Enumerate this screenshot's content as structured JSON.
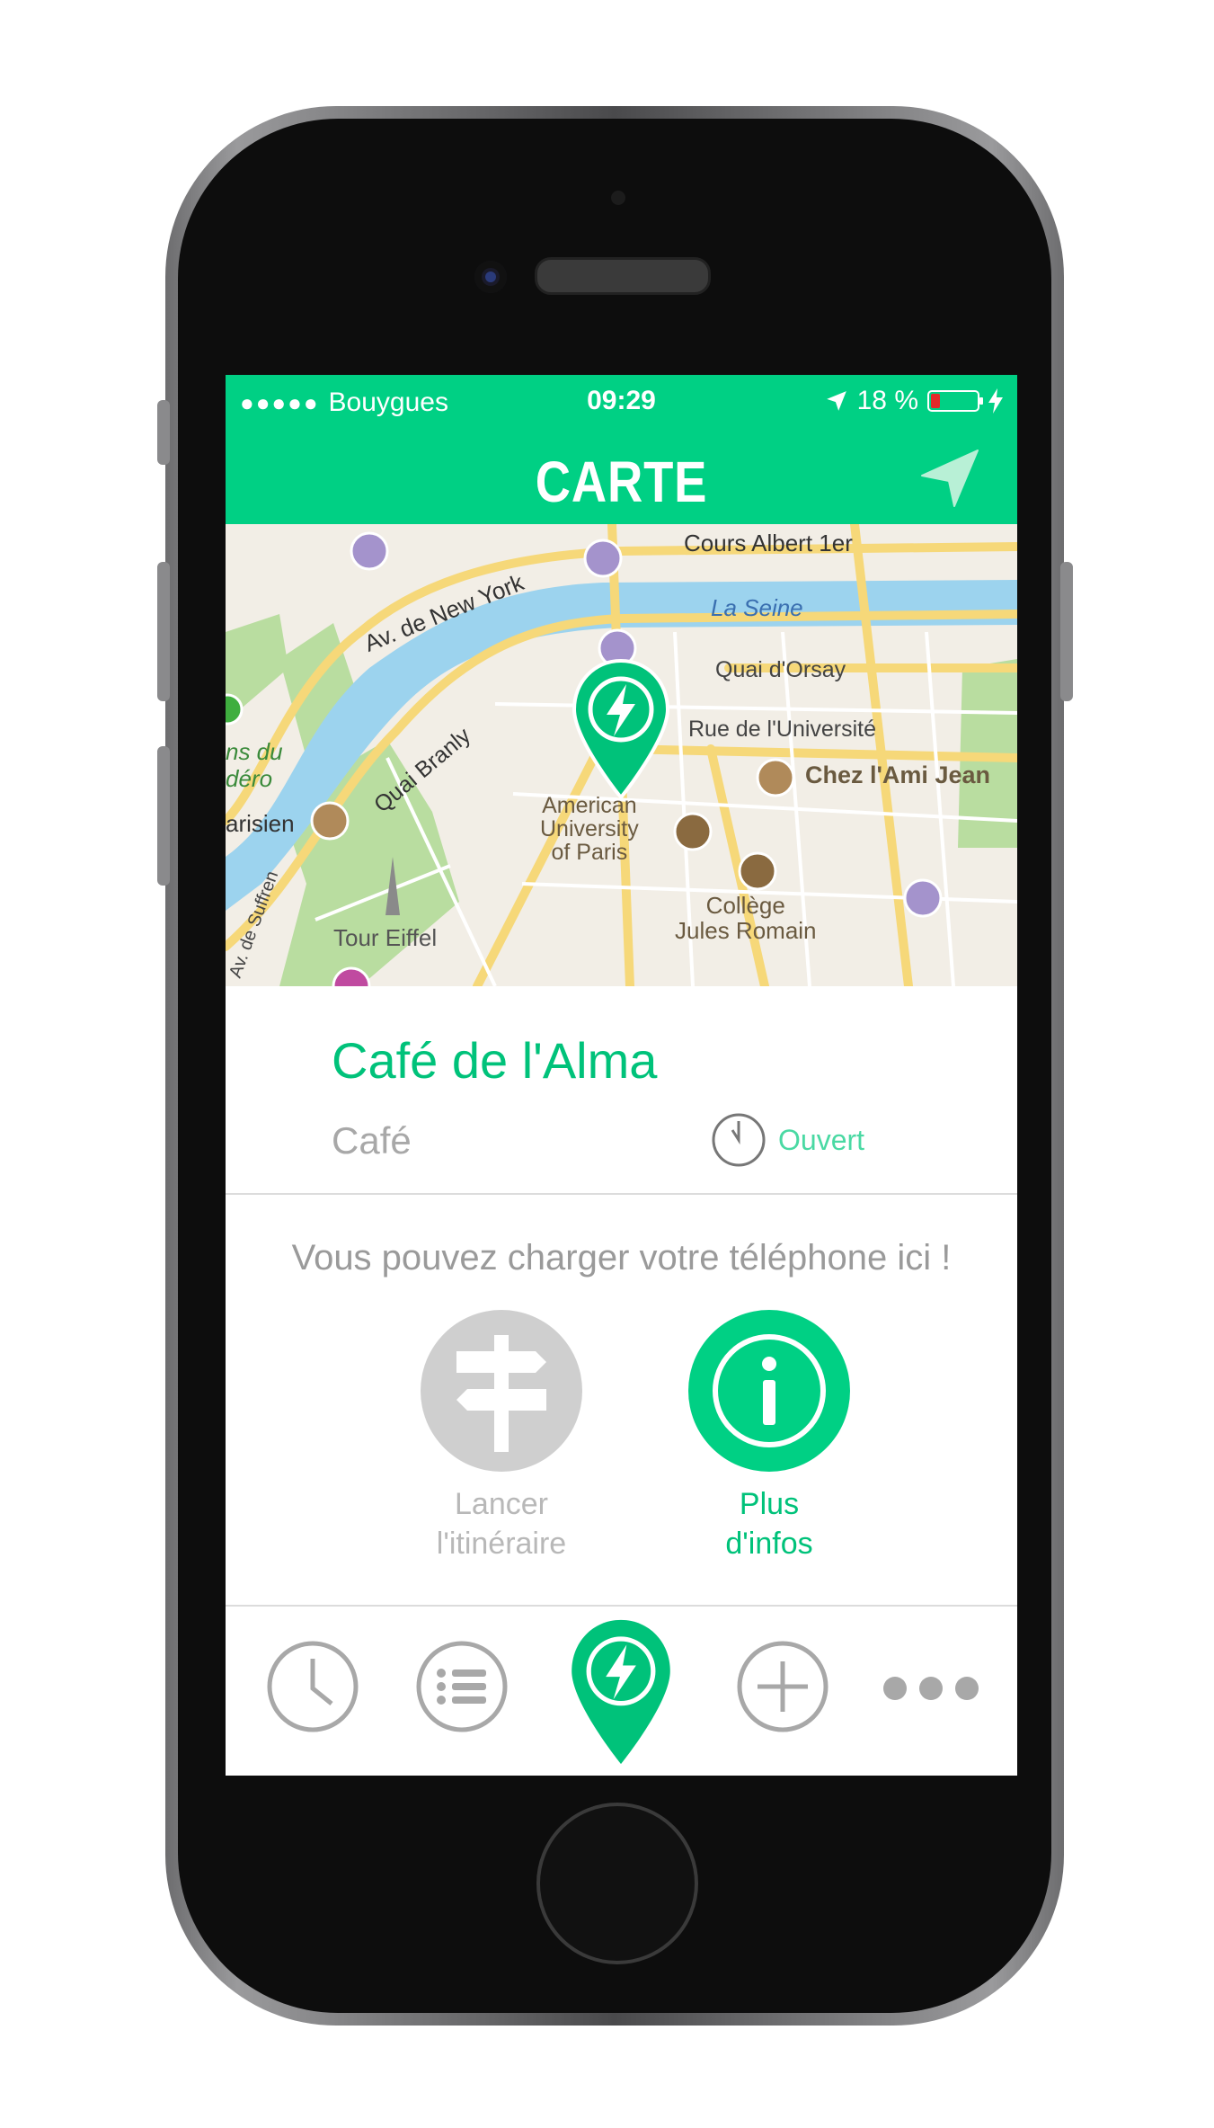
{
  "status_bar": {
    "carrier": "Bouygues",
    "time": "09:29",
    "battery": "18 %"
  },
  "nav": {
    "title": "CARTE"
  },
  "map": {
    "labels": {
      "cours_albert": "Cours Albert 1er",
      "seine": "La Seine",
      "av_new_york": "Av. de New York",
      "quai_orsay": "Quai d'Orsay",
      "rue_universite": "Rue de l'Université",
      "quai_branly": "Quai Branly",
      "chez_ami_jean": "Chez l'Ami Jean",
      "american_university": "American\nUniversity\nof Paris",
      "college_jules": "Collège\nJules Romain",
      "tour_eiffel": "Tour Eiffel",
      "suffren": "Av. de Suffren",
      "parisien": "arisien",
      "jardins": "ns du\ndéro"
    }
  },
  "place": {
    "name": "Café de l'Alma",
    "type": "Café",
    "status": "Ouvert"
  },
  "promo": "Vous pouvez charger votre téléphone ici !",
  "actions": {
    "route": "Lancer\nl'itinéraire",
    "info": "Plus\nd'infos"
  },
  "colors": {
    "accent": "#00d084",
    "gray": "#cfcfcf"
  }
}
